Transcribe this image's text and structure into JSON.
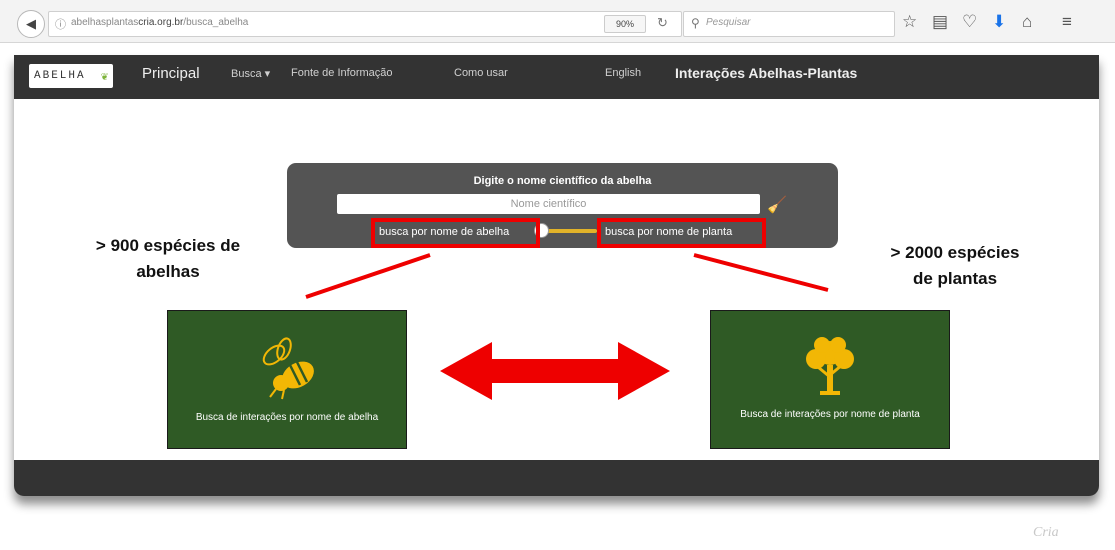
{
  "browser": {
    "url_prefix": "abelhasplantas",
    "url_domain": "cria.org.br",
    "url_path": "/busca_abelha",
    "zoom": "90%",
    "search_placeholder": "Pesquisar"
  },
  "navbar": {
    "logo_text": "ABELHA",
    "main": "Principal",
    "busca": "Busca ▾",
    "fonte": "Fonte de Informação",
    "como_usar": "Como usar",
    "english": "English",
    "title": "Interações Abelhas-Plantas"
  },
  "search_panel": {
    "title": "Digite o nome científico da abelha",
    "placeholder": "Nome científico",
    "option_bee": "busca por nome de abelha",
    "option_plant": "busca por nome de planta"
  },
  "annotations": {
    "bees_line1": "> 900 espécies de",
    "bees_line2": "abelhas",
    "plants_line1": "> 2000 espécies",
    "plants_line2": "de plantas"
  },
  "tiles": {
    "bee_label": "Busca de interações por nome de abelha",
    "plant_label": "Busca de interações por nome de planta"
  },
  "watermark": "Cria",
  "colors": {
    "navbar": "#333333",
    "panel": "#545454",
    "tile_green": "#2f5a25",
    "accent_yellow": "#f2b705",
    "callout_red": "#ee0000"
  },
  "icons": {
    "back": "back-arrow-icon",
    "info": "info-icon",
    "reload": "reload-icon",
    "search": "search-icon",
    "bookmark_star": "bookmark-star-icon",
    "reading_list": "reading-list-icon",
    "pocket": "pocket-icon",
    "download": "download-icon",
    "home": "home-icon",
    "menu": "hamburger-menu-icon",
    "broom": "broom-icon",
    "bee": "bee-icon",
    "tree": "tree-icon"
  }
}
